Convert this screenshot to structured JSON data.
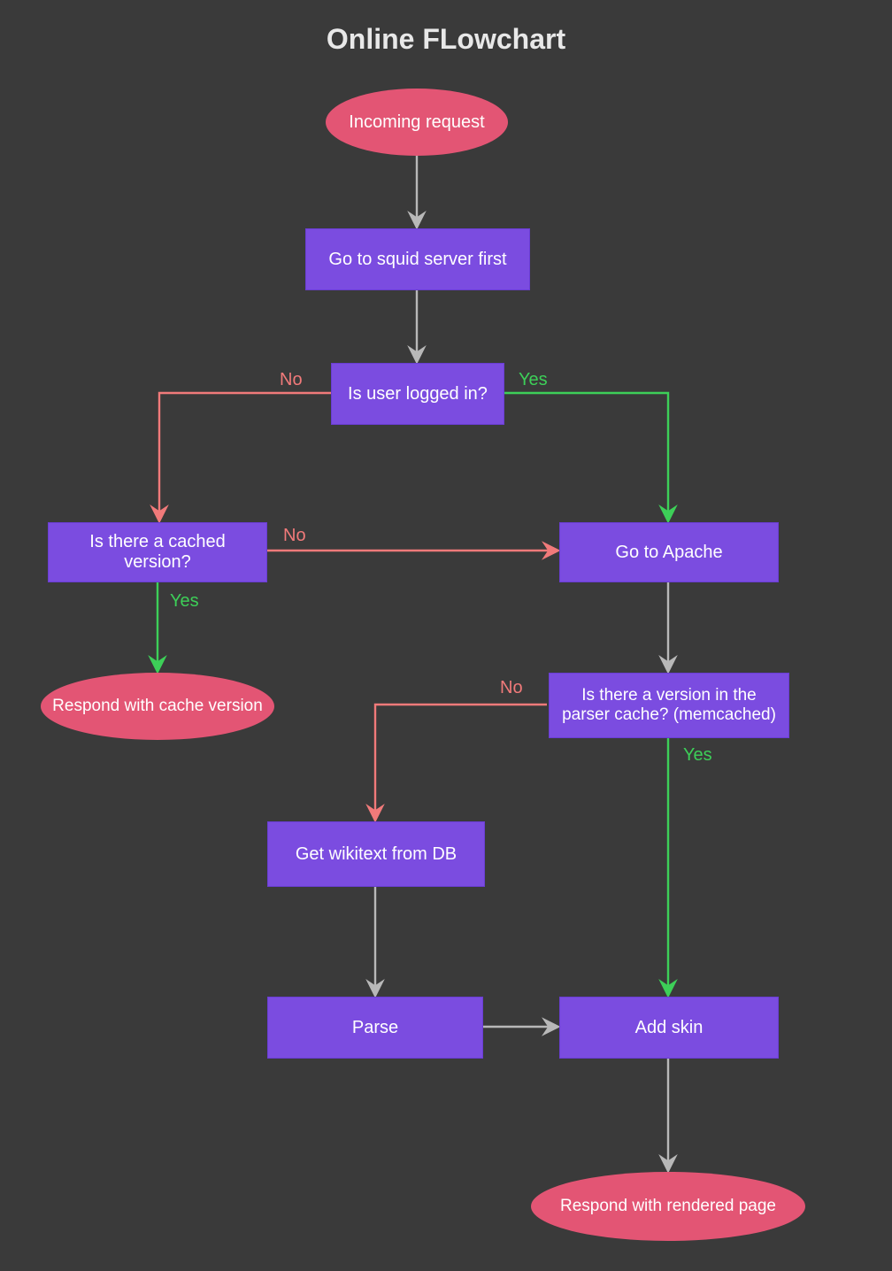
{
  "title": "Online FLowchart",
  "nodes": {
    "start": {
      "label": "Incoming request"
    },
    "squid": {
      "label": "Go to squid server first"
    },
    "logged": {
      "label": "Is user logged in?"
    },
    "cached": {
      "label": "Is there a cached version?"
    },
    "apache": {
      "label": "Go to Apache"
    },
    "respond_cache": {
      "label": "Respond with cache version"
    },
    "parser_cache": {
      "label": "Is there a version in the parser cache? (memcached)"
    },
    "get_wikitext": {
      "label": "Get wikitext from DB"
    },
    "parse": {
      "label": "Parse"
    },
    "add_skin": {
      "label": "Add skin"
    },
    "respond_page": {
      "label": "Respond with rendered page"
    }
  },
  "labels": {
    "logged_no": "No",
    "logged_yes": "Yes",
    "cached_no": "No",
    "cached_yes": "Yes",
    "parser_no": "No",
    "parser_yes": "Yes"
  },
  "colors": {
    "bg": "#3a3a3a",
    "process": "#7b4ce0",
    "terminator": "#e35574",
    "arrow_gray": "#b8b8b8",
    "arrow_no": "#f17a7a",
    "arrow_yes": "#3dcf58"
  },
  "edges": [
    {
      "from": "start",
      "to": "squid",
      "style": "gray"
    },
    {
      "from": "squid",
      "to": "logged",
      "style": "gray"
    },
    {
      "from": "logged",
      "to": "cached",
      "style": "no",
      "label": "No"
    },
    {
      "from": "logged",
      "to": "apache",
      "style": "yes",
      "label": "Yes"
    },
    {
      "from": "cached",
      "to": "apache",
      "style": "no",
      "label": "No"
    },
    {
      "from": "cached",
      "to": "respond_cache",
      "style": "yes",
      "label": "Yes"
    },
    {
      "from": "apache",
      "to": "parser_cache",
      "style": "gray"
    },
    {
      "from": "parser_cache",
      "to": "get_wikitext",
      "style": "no",
      "label": "No"
    },
    {
      "from": "parser_cache",
      "to": "add_skin",
      "style": "yes",
      "label": "Yes"
    },
    {
      "from": "get_wikitext",
      "to": "parse",
      "style": "gray"
    },
    {
      "from": "parse",
      "to": "add_skin",
      "style": "gray"
    },
    {
      "from": "add_skin",
      "to": "respond_page",
      "style": "gray"
    }
  ]
}
